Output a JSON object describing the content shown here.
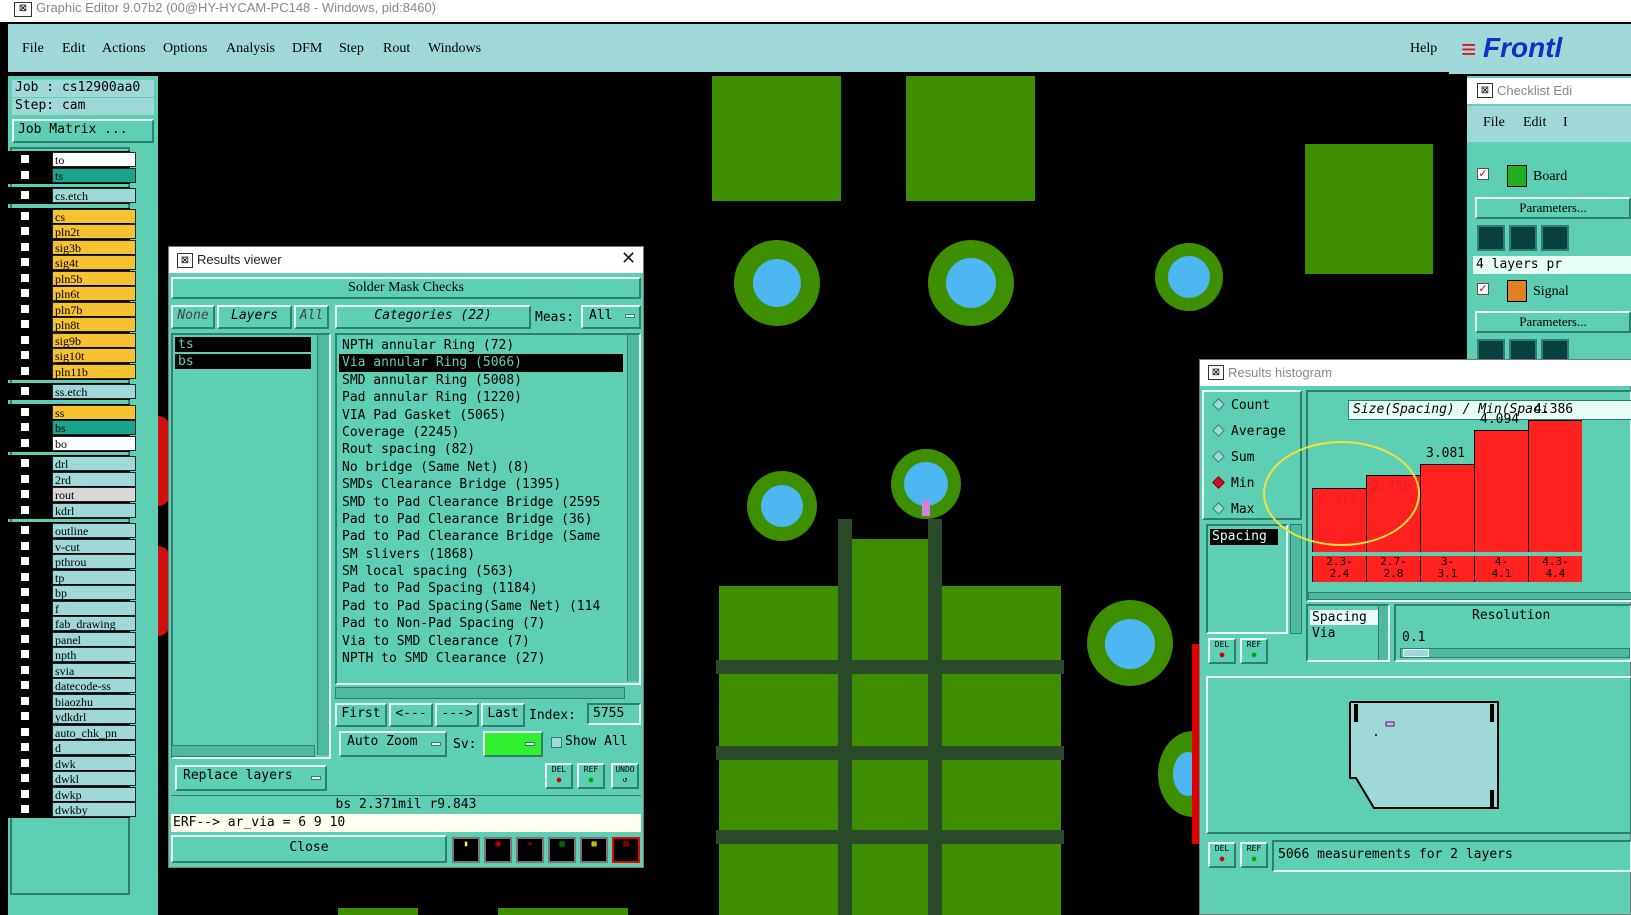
{
  "window": {
    "title": "Graphic Editor 9.07b2 (00@HY-HYCAM-PC148 - Windows, pid:8460)"
  },
  "menu": {
    "items": [
      "File",
      "Edit",
      "Actions",
      "Options",
      "Analysis",
      "DFM",
      "Step",
      "Rout",
      "Windows"
    ],
    "help": "Help",
    "logo": "Frontl"
  },
  "job": {
    "job": "Job : cs12900aa0",
    "step": "Step: cam",
    "matrix_button": "Job Matrix ..."
  },
  "layers": [
    {
      "name": "to",
      "color": "#ffffff"
    },
    {
      "name": "ts",
      "color": "#1aa58a"
    },
    {
      "name": "cs.etch",
      "color": "#9fd9d7"
    },
    {
      "name": "cs",
      "color": "#f6c232"
    },
    {
      "name": "pln2t",
      "color": "#f6c232"
    },
    {
      "name": "sig3b",
      "color": "#f6c232"
    },
    {
      "name": "sig4t",
      "color": "#f6c232"
    },
    {
      "name": "pln5b",
      "color": "#f6c232"
    },
    {
      "name": "pln6t",
      "color": "#f6c232"
    },
    {
      "name": "pln7b",
      "color": "#f6c232"
    },
    {
      "name": "pln8t",
      "color": "#f6c232"
    },
    {
      "name": "sig9b",
      "color": "#f6c232"
    },
    {
      "name": "sig10t",
      "color": "#f6c232"
    },
    {
      "name": "pln11b",
      "color": "#f6c232"
    },
    {
      "name": "ss.etch",
      "color": "#9fd9d7"
    },
    {
      "name": "ss",
      "color": "#f6c232"
    },
    {
      "name": "bs",
      "color": "#1aa58a"
    },
    {
      "name": "bo",
      "color": "#ffffff"
    },
    {
      "name": "drl",
      "color": "#9fd9d7"
    },
    {
      "name": "2rd",
      "color": "#9fd9d7"
    },
    {
      "name": "rout",
      "color": "#d8d8d8"
    },
    {
      "name": "kdrl",
      "color": "#9fd9d7"
    },
    {
      "name": "outline",
      "color": "#9fd9d7"
    },
    {
      "name": "v-cut",
      "color": "#9fd9d7"
    },
    {
      "name": "pthrou",
      "color": "#9fd9d7"
    },
    {
      "name": "tp",
      "color": "#9fd9d7"
    },
    {
      "name": "bp",
      "color": "#9fd9d7"
    },
    {
      "name": "f",
      "color": "#9fd9d7"
    },
    {
      "name": "fab_drawing",
      "color": "#9fd9d7"
    },
    {
      "name": "panel",
      "color": "#9fd9d7"
    },
    {
      "name": "npth",
      "color": "#9fd9d7"
    },
    {
      "name": "svia",
      "color": "#9fd9d7"
    },
    {
      "name": "datecode-ss",
      "color": "#9fd9d7"
    },
    {
      "name": "biaozhu",
      "color": "#9fd9d7"
    },
    {
      "name": "ydkdrl",
      "color": "#9fd9d7"
    },
    {
      "name": "auto_chk_pn",
      "color": "#9fd9d7"
    },
    {
      "name": "d",
      "color": "#9fd9d7"
    },
    {
      "name": "dwk",
      "color": "#9fd9d7"
    },
    {
      "name": "dwkl",
      "color": "#9fd9d7"
    },
    {
      "name": "dwkp",
      "color": "#9fd9d7"
    },
    {
      "name": "dwkby",
      "color": "#9fd9d7"
    }
  ],
  "results_viewer": {
    "title": "Results viewer",
    "header": "Solder Mask Checks",
    "none_btn": "None",
    "layers_btn": "Layers",
    "all_btn": "All",
    "categories_btn": "Categories (22)",
    "meas_label": "Meas:",
    "meas_value": "All",
    "layer_list": [
      "ts",
      "bs"
    ],
    "categories": [
      "NPTH annular Ring (72)",
      "Via annular Ring (5066)",
      "SMD annular Ring (5008)",
      "Pad annular Ring (1220)",
      "VIA Pad Gasket (5065)",
      "Coverage (2245)",
      "Rout spacing (82)",
      "No bridge (Same Net) (8)",
      "SMDs Clearance Bridge (1395)",
      "SMD to Pad Clearance Bridge (2595",
      "Pad to Pad Clearance Bridge (36)",
      "Pad to Pad Clearance Bridge (Same",
      "SM slivers (1868)",
      "SM local spacing (563)",
      "Pad to Pad Spacing (1184)",
      "Pad to Pad Spacing(Same Net) (114",
      "Pad to Non-Pad Spacing (7)",
      "Via to SMD Clearance (7)",
      "NPTH to SMD Clearance (27)"
    ],
    "selected_index": 1,
    "first_btn": "First",
    "prev_btn": "<---",
    "next_btn": "--->",
    "last_btn": "Last",
    "index_label": "Index:",
    "index_value": "5755",
    "auto_zoom": "Auto Zoom",
    "sv_label": "Sv:",
    "show_all": "Show All",
    "replace_layers": "Replace layers",
    "status": "bs 2.371mil  r9.843",
    "erf": "ERF--> ar_via = 6 9 10",
    "close": "Close",
    "del": "DEL",
    "ref": "REF",
    "undo": "UNDO"
  },
  "histogram": {
    "title": "Results histogram",
    "options": [
      "Count",
      "Average",
      "Sum",
      "Min",
      "Max"
    ],
    "selected_option": "Min",
    "measure_list": [
      "Spacing"
    ],
    "axis_label": "Size(Spacing) / Min(Spaci",
    "bars": [
      {
        "value": "2.371",
        "bin": "2.3-\n2.4",
        "level": 0.46
      },
      {
        "value": "2.756",
        "bin": "2.7-\n2.8",
        "level": 0.55
      },
      {
        "value": "3.081",
        "bin": "3-\n3.1",
        "level": 0.63
      },
      {
        "value": "4.094",
        "bin": "4-\n4.1",
        "level": 0.87
      },
      {
        "value": "4.386",
        "bin": "4.3-\n4.4",
        "level": 0.94
      }
    ],
    "spacing_box": [
      "Spacing",
      "Via"
    ],
    "resolution_label": "Resolution",
    "resolution_value": "0.1",
    "summary": "5066 measurements for 2 layers",
    "del": "DEL",
    "ref": "REF"
  },
  "checklist": {
    "title": "Checklist Edi",
    "menu": [
      "File",
      "Edit",
      "I"
    ],
    "board": "Board",
    "params": "Parameters...",
    "layers_text": "4 layers pr",
    "signal": "Signal",
    "params2": "Parameters..."
  },
  "colors": {
    "panel": "#5fcfb3",
    "menu": "#9fd9d7",
    "copper": "#3e8f00",
    "drill": "#4cb7f0",
    "bar": "#ff2020"
  }
}
